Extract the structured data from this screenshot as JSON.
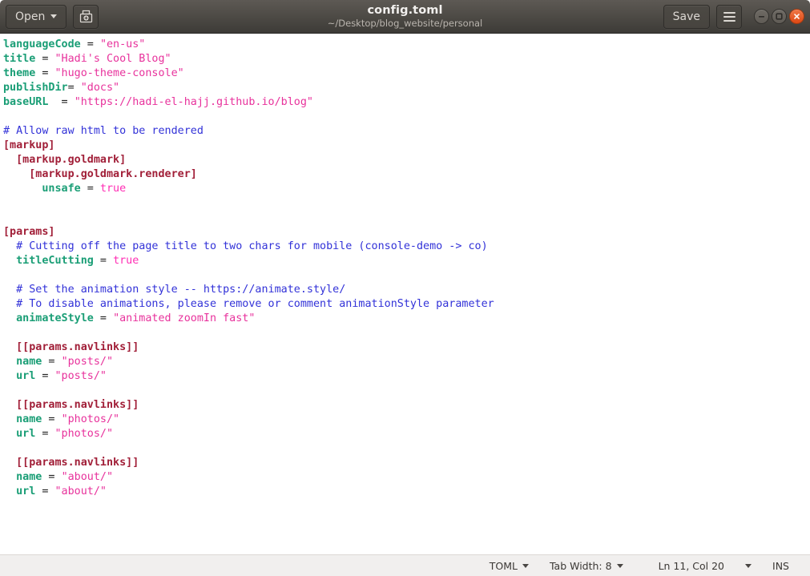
{
  "window": {
    "title": "config.toml",
    "subtitle": "~/Desktop/blog_website/personal",
    "open_label": "Open",
    "save_label": "Save",
    "new_doc_icon": "new-document-icon",
    "menu_icon": "hamburger-menu-icon",
    "minimize_icon": "minimize-icon",
    "maximize_icon": "maximize-icon",
    "close_icon": "close-icon",
    "close_color": "#dd4814"
  },
  "statusbar": {
    "language": "TOML",
    "tab_width": "Tab Width: 8",
    "position": "Ln 11, Col 20",
    "insert_mode": "INS"
  },
  "theme": {
    "key_color": "#1a9e76",
    "string_color": "#e8329c",
    "comment_color": "#3232d8",
    "table_color": "#a11f38",
    "bool_color": "#ff2eb4",
    "background": "#ffffff",
    "statusbar_background": "#f1efee"
  },
  "document": {
    "filename": "config.toml",
    "language": "TOML",
    "lines": [
      [
        {
          "t": "key",
          "v": "languageCode"
        },
        {
          "t": "op",
          "v": " = "
        },
        {
          "t": "str",
          "v": "\"en-us\""
        }
      ],
      [
        {
          "t": "key",
          "v": "title"
        },
        {
          "t": "op",
          "v": " = "
        },
        {
          "t": "str",
          "v": "\"Hadi's Cool Blog\""
        }
      ],
      [
        {
          "t": "key",
          "v": "theme"
        },
        {
          "t": "op",
          "v": " = "
        },
        {
          "t": "str",
          "v": "\"hugo-theme-console\""
        }
      ],
      [
        {
          "t": "key",
          "v": "publishDir"
        },
        {
          "t": "op",
          "v": "= "
        },
        {
          "t": "str",
          "v": "\"docs\""
        }
      ],
      [
        {
          "t": "key",
          "v": "baseURL"
        },
        {
          "t": "op",
          "v": "  = "
        },
        {
          "t": "str",
          "v": "\"https://hadi-el-hajj.github.io/blog\""
        }
      ],
      [],
      [
        {
          "t": "comment",
          "v": "# Allow raw html to be rendered"
        }
      ],
      [
        {
          "t": "table",
          "v": "[markup]"
        }
      ],
      [
        {
          "t": "plain",
          "v": "  "
        },
        {
          "t": "table",
          "v": "[markup.goldmark]"
        }
      ],
      [
        {
          "t": "plain",
          "v": "    "
        },
        {
          "t": "table",
          "v": "[markup.goldmark.renderer]"
        }
      ],
      [
        {
          "t": "plain",
          "v": "      "
        },
        {
          "t": "key",
          "v": "unsafe"
        },
        {
          "t": "op",
          "v": " = "
        },
        {
          "t": "bool",
          "v": "true"
        }
      ],
      [],
      [],
      [
        {
          "t": "table",
          "v": "[params]"
        }
      ],
      [
        {
          "t": "plain",
          "v": "  "
        },
        {
          "t": "comment",
          "v": "# Cutting off the page title to two chars for mobile (console-demo -> co)"
        }
      ],
      [
        {
          "t": "plain",
          "v": "  "
        },
        {
          "t": "key",
          "v": "titleCutting"
        },
        {
          "t": "op",
          "v": " = "
        },
        {
          "t": "bool",
          "v": "true"
        }
      ],
      [],
      [
        {
          "t": "plain",
          "v": "  "
        },
        {
          "t": "comment",
          "v": "# Set the animation style -- https://animate.style/"
        }
      ],
      [
        {
          "t": "plain",
          "v": "  "
        },
        {
          "t": "comment",
          "v": "# To disable animations, please remove or comment animationStyle parameter"
        }
      ],
      [
        {
          "t": "plain",
          "v": "  "
        },
        {
          "t": "key",
          "v": "animateStyle"
        },
        {
          "t": "op",
          "v": " = "
        },
        {
          "t": "str",
          "v": "\"animated zoomIn fast\""
        }
      ],
      [],
      [
        {
          "t": "plain",
          "v": "  "
        },
        {
          "t": "table",
          "v": "[[params.navlinks]]"
        }
      ],
      [
        {
          "t": "plain",
          "v": "  "
        },
        {
          "t": "key",
          "v": "name"
        },
        {
          "t": "op",
          "v": " = "
        },
        {
          "t": "str",
          "v": "\"posts/\""
        }
      ],
      [
        {
          "t": "plain",
          "v": "  "
        },
        {
          "t": "key",
          "v": "url"
        },
        {
          "t": "op",
          "v": " = "
        },
        {
          "t": "str",
          "v": "\"posts/\""
        }
      ],
      [],
      [
        {
          "t": "plain",
          "v": "  "
        },
        {
          "t": "table",
          "v": "[[params.navlinks]]"
        }
      ],
      [
        {
          "t": "plain",
          "v": "  "
        },
        {
          "t": "key",
          "v": "name"
        },
        {
          "t": "op",
          "v": " = "
        },
        {
          "t": "str",
          "v": "\"photos/\""
        }
      ],
      [
        {
          "t": "plain",
          "v": "  "
        },
        {
          "t": "key",
          "v": "url"
        },
        {
          "t": "op",
          "v": " = "
        },
        {
          "t": "str",
          "v": "\"photos/\""
        }
      ],
      [],
      [
        {
          "t": "plain",
          "v": "  "
        },
        {
          "t": "table",
          "v": "[[params.navlinks]]"
        }
      ],
      [
        {
          "t": "plain",
          "v": "  "
        },
        {
          "t": "key",
          "v": "name"
        },
        {
          "t": "op",
          "v": " = "
        },
        {
          "t": "str",
          "v": "\"about/\""
        }
      ],
      [
        {
          "t": "plain",
          "v": "  "
        },
        {
          "t": "key",
          "v": "url"
        },
        {
          "t": "op",
          "v": " = "
        },
        {
          "t": "str",
          "v": "\"about/\""
        }
      ]
    ]
  }
}
